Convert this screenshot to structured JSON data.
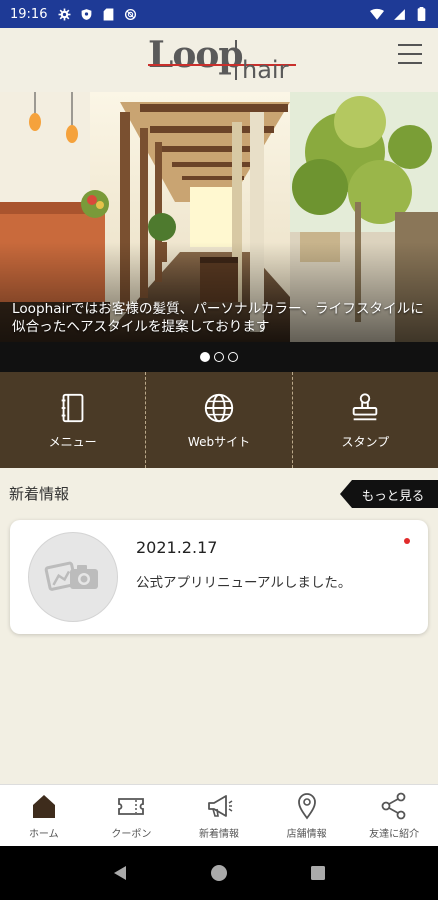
{
  "status_bar": {
    "time": "19:16",
    "left_icons": [
      "gear-icon",
      "shield-icon",
      "sd-card-icon",
      "no-disturb-icon"
    ],
    "right_icons": [
      "wifi-icon",
      "signal-icon",
      "battery-icon"
    ]
  },
  "header": {
    "logo_part1": "Loop",
    "logo_part2": "hair",
    "menu_icon": "hamburger-menu-icon"
  },
  "hero": {
    "caption": "Loophairではお客様の髪質、パーソナルカラー、ライフスタイルに似合ったヘアスタイルを提案しております",
    "slides_total": 3,
    "active_slide": 1
  },
  "quick_nav": [
    {
      "label": "メニュー",
      "icon": "book-icon"
    },
    {
      "label": "Webサイト",
      "icon": "globe-icon"
    },
    {
      "label": "スタンプ",
      "icon": "stamp-icon"
    }
  ],
  "news": {
    "section_title": "新着情報",
    "more_label": "もっと見る",
    "items": [
      {
        "date": "2021.2.17",
        "text": "公式アプリリニューアルしました。",
        "unread": true
      }
    ]
  },
  "tab_bar": [
    {
      "label": "ホーム",
      "icon": "home-icon",
      "active": true
    },
    {
      "label": "クーポン",
      "icon": "coupon-icon"
    },
    {
      "label": "新着情報",
      "icon": "megaphone-icon"
    },
    {
      "label": "店舗情報",
      "icon": "map-pin-icon"
    },
    {
      "label": "友達に紹介",
      "icon": "share-icon"
    }
  ],
  "colors": {
    "status_bar": "#1e3a96",
    "background": "#f2efe3",
    "quick_nav_bg": "#4a3a26",
    "accent_red": "#c9302c"
  }
}
